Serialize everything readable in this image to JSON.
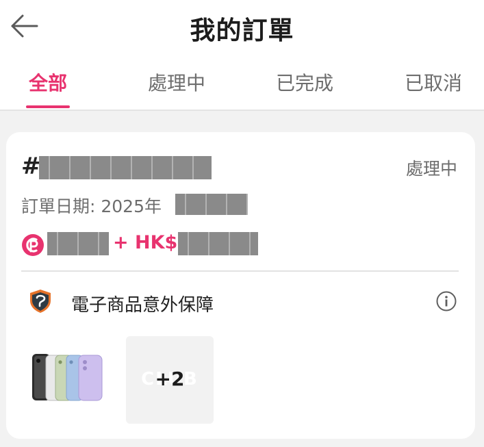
{
  "header": {
    "title": "我的訂單",
    "back_icon": "arrow-left-icon"
  },
  "tabs": [
    {
      "label": "全部",
      "active": true
    },
    {
      "label": "處理中",
      "active": false
    },
    {
      "label": "已完成",
      "active": false
    },
    {
      "label": "已取消",
      "active": false
    }
  ],
  "order": {
    "hash": "#",
    "status": "處理中",
    "date_label": "訂單日期: 2025年",
    "price_connector": "+ HK$",
    "insurance_label": "電子商品意外保障",
    "more_count": "+2",
    "watermark": "CLUB"
  },
  "colors": {
    "accent": "#e8336f",
    "muted_text": "#6d6d6d",
    "page_bg": "#f2f2f2"
  }
}
